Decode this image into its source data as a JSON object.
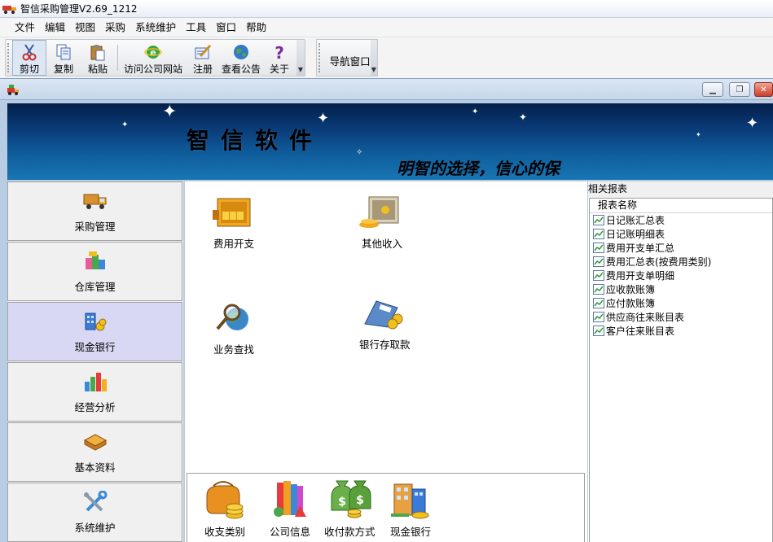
{
  "window": {
    "title": "智信采购管理V2.69_1212"
  },
  "menu": [
    "文件",
    "编辑",
    "视图",
    "采购",
    "系统维护",
    "工具",
    "窗口",
    "帮助"
  ],
  "toolbar": {
    "cut": "剪切",
    "copy": "复制",
    "paste": "粘贴",
    "visit_site": "访问公司网站",
    "register": "注册",
    "announcement": "查看公告",
    "about": "关于",
    "nav_window": "导航窗口"
  },
  "banner": {
    "brand": "智信软件",
    "slogan": "明智的选择，信心的保"
  },
  "nav": [
    {
      "label": "采购管理",
      "icon": "truck-icon"
    },
    {
      "label": "仓库管理",
      "icon": "warehouse-icon"
    },
    {
      "label": "现金银行",
      "icon": "cash-bank-icon",
      "active": true
    },
    {
      "label": "经营分析",
      "icon": "analysis-chart-icon"
    },
    {
      "label": "基本资料",
      "icon": "book-icon"
    },
    {
      "label": "系统维护",
      "icon": "tools-icon"
    }
  ],
  "content": {
    "items": [
      {
        "label": "费用开支",
        "icon": "safe-gold-icon"
      },
      {
        "label": "其他收入",
        "icon": "safe-open-icon"
      },
      {
        "label": "业务查找",
        "icon": "magnifier-globe-icon"
      },
      {
        "label": "银行存取款",
        "icon": "bank-card-icon"
      }
    ]
  },
  "shortcuts": [
    {
      "label": "收支类别",
      "icon": "purse-coins-icon"
    },
    {
      "label": "公司信息",
      "icon": "books-icon"
    },
    {
      "label": "收付款方式",
      "icon": "money-bags-icon"
    },
    {
      "label": "现金银行",
      "icon": "bank-building-icon"
    }
  ],
  "report": {
    "caption": "相关报表",
    "column_header": "报表名称",
    "items": [
      "日记账汇总表",
      "日记账明细表",
      "费用开支单汇总",
      "费用汇总表(按费用类别)",
      "费用开支单明细",
      "应收款账簿",
      "应付款账簿",
      "供应商往来账目表",
      "客户往来账目表"
    ]
  },
  "colors": {
    "banner_top": "#041f4a",
    "banner_bottom": "#1976b3",
    "nav_active": "#d8d8f4",
    "child_frame": "#b8cce4"
  }
}
